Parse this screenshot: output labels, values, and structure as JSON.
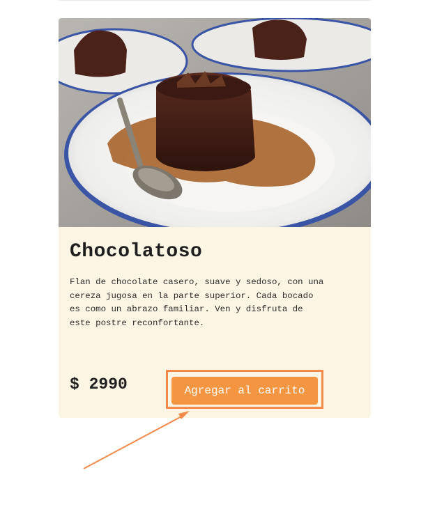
{
  "product": {
    "title": "Chocolatoso",
    "description": "Flan de chocolate casero, suave y sedoso, con una cereza jugosa en la parte superior. Cada bocado es como un abrazo familiar. Ven y disfruta de este postre reconfortante.",
    "price": "$ 2990",
    "image_alt": "Chocolatoso"
  },
  "actions": {
    "add_to_cart_label": "Agregar al carrito"
  },
  "colors": {
    "card_background": "#fdf5e3",
    "button": "#f49542",
    "highlight": "#f38a4a"
  }
}
